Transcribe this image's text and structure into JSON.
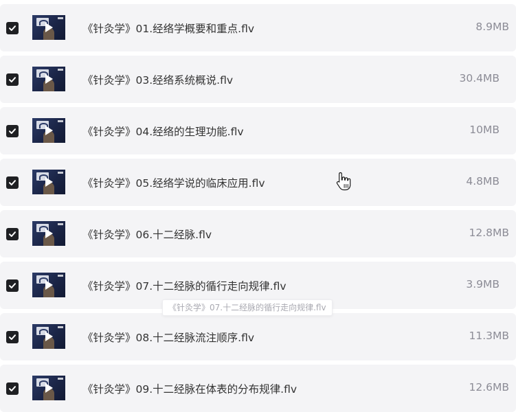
{
  "files": [
    {
      "name": "《针灸学》01.经络学概要和重点.flv",
      "size": "8.9MB",
      "checked": true
    },
    {
      "name": "《针灸学》03.经络系统概说.flv",
      "size": "30.4MB",
      "checked": true
    },
    {
      "name": "《针灸学》04.经络的生理功能.flv",
      "size": "10MB",
      "checked": true
    },
    {
      "name": "《针灸学》05.经络学说的临床应用.flv",
      "size": "4.8MB",
      "checked": true
    },
    {
      "name": "《针灸学》06.十二经脉.flv",
      "size": "12.8MB",
      "checked": true
    },
    {
      "name": "《针灸学》07.十二经脉的循行走向规律.flv",
      "size": "3.9MB",
      "checked": true
    },
    {
      "name": "《针灸学》08.十二经脉流注顺序.flv",
      "size": "11.3MB",
      "checked": true
    },
    {
      "name": "《针灸学》09.十二经脉在体表的分布规律.flv",
      "size": "12.6MB",
      "checked": true
    }
  ],
  "tooltip": {
    "text": "《针灸学》07.十二经脉的循行走向规律.flv"
  },
  "icons": {
    "checkbox": "check-icon",
    "thumbnail": "video-thumbnail",
    "play": "play-icon",
    "cursor": "hand-pointer-icon"
  },
  "colors": {
    "row_background": "#f4f4f6",
    "checkbox_fill": "#1f2023",
    "filename_text": "#333333",
    "filesize_text": "#8c8c96"
  }
}
